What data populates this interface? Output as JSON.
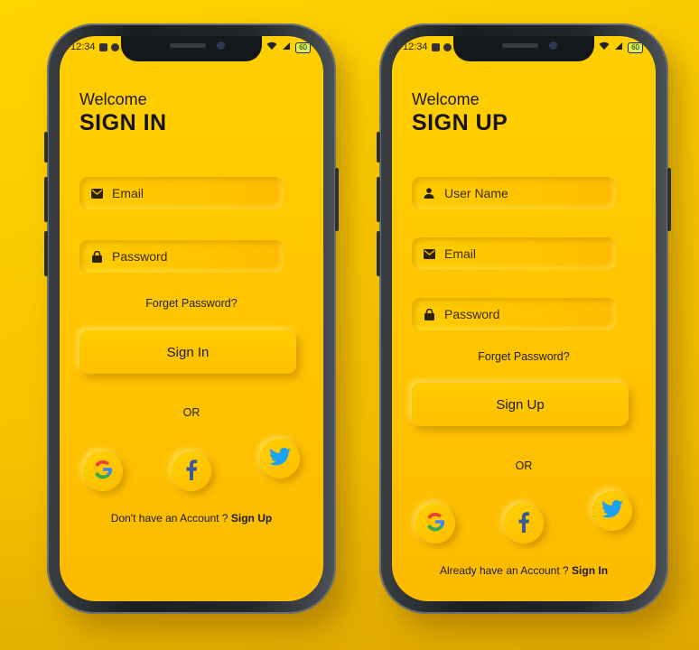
{
  "status_bar": {
    "time": "12:34",
    "battery": "60"
  },
  "signin": {
    "welcome": "Welcome",
    "title": "SIGN IN",
    "email_placeholder": "Email",
    "password_placeholder": "Password",
    "forgot": "Forget Password?",
    "button": "Sign In",
    "or": "OR",
    "footer_text": "Don't have an Account ?",
    "footer_link": "Sign Up"
  },
  "signup": {
    "welcome": "Welcome",
    "title": "SIGN UP",
    "username_placeholder": "User Name",
    "email_placeholder": "Email",
    "password_placeholder": "Password",
    "forgot": "Forget Password?",
    "button": "Sign Up",
    "or": "OR",
    "footer_text": "Already have an Account ?",
    "footer_link": "Sign In"
  },
  "social": [
    "google-icon",
    "facebook-icon",
    "twitter-icon"
  ],
  "colors": {
    "background": "#ffcc00",
    "screen": "#ffc400",
    "text": "#1a1a1a",
    "google_blue": "#4285F4",
    "google_red": "#EA4335",
    "google_yellow": "#FBBC05",
    "google_green": "#34A853",
    "facebook": "#3b5998",
    "twitter": "#1DA1F2"
  }
}
